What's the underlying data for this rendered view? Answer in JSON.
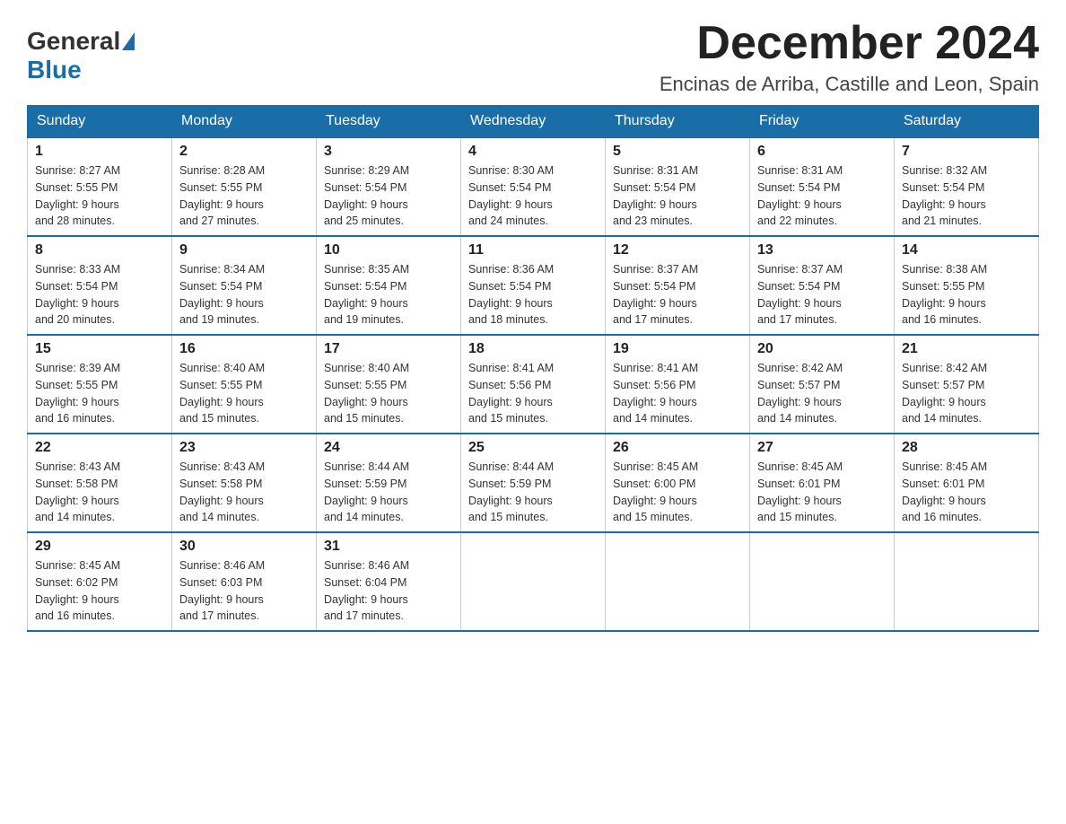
{
  "header": {
    "logo_general": "General",
    "logo_blue": "Blue",
    "month_title": "December 2024",
    "location": "Encinas de Arriba, Castille and Leon, Spain"
  },
  "weekdays": [
    "Sunday",
    "Monday",
    "Tuesday",
    "Wednesday",
    "Thursday",
    "Friday",
    "Saturday"
  ],
  "weeks": [
    [
      {
        "day": "1",
        "sunrise": "8:27 AM",
        "sunset": "5:55 PM",
        "daylight": "9 hours and 28 minutes."
      },
      {
        "day": "2",
        "sunrise": "8:28 AM",
        "sunset": "5:55 PM",
        "daylight": "9 hours and 27 minutes."
      },
      {
        "day": "3",
        "sunrise": "8:29 AM",
        "sunset": "5:54 PM",
        "daylight": "9 hours and 25 minutes."
      },
      {
        "day": "4",
        "sunrise": "8:30 AM",
        "sunset": "5:54 PM",
        "daylight": "9 hours and 24 minutes."
      },
      {
        "day": "5",
        "sunrise": "8:31 AM",
        "sunset": "5:54 PM",
        "daylight": "9 hours and 23 minutes."
      },
      {
        "day": "6",
        "sunrise": "8:31 AM",
        "sunset": "5:54 PM",
        "daylight": "9 hours and 22 minutes."
      },
      {
        "day": "7",
        "sunrise": "8:32 AM",
        "sunset": "5:54 PM",
        "daylight": "9 hours and 21 minutes."
      }
    ],
    [
      {
        "day": "8",
        "sunrise": "8:33 AM",
        "sunset": "5:54 PM",
        "daylight": "9 hours and 20 minutes."
      },
      {
        "day": "9",
        "sunrise": "8:34 AM",
        "sunset": "5:54 PM",
        "daylight": "9 hours and 19 minutes."
      },
      {
        "day": "10",
        "sunrise": "8:35 AM",
        "sunset": "5:54 PM",
        "daylight": "9 hours and 19 minutes."
      },
      {
        "day": "11",
        "sunrise": "8:36 AM",
        "sunset": "5:54 PM",
        "daylight": "9 hours and 18 minutes."
      },
      {
        "day": "12",
        "sunrise": "8:37 AM",
        "sunset": "5:54 PM",
        "daylight": "9 hours and 17 minutes."
      },
      {
        "day": "13",
        "sunrise": "8:37 AM",
        "sunset": "5:54 PM",
        "daylight": "9 hours and 17 minutes."
      },
      {
        "day": "14",
        "sunrise": "8:38 AM",
        "sunset": "5:55 PM",
        "daylight": "9 hours and 16 minutes."
      }
    ],
    [
      {
        "day": "15",
        "sunrise": "8:39 AM",
        "sunset": "5:55 PM",
        "daylight": "9 hours and 16 minutes."
      },
      {
        "day": "16",
        "sunrise": "8:40 AM",
        "sunset": "5:55 PM",
        "daylight": "9 hours and 15 minutes."
      },
      {
        "day": "17",
        "sunrise": "8:40 AM",
        "sunset": "5:55 PM",
        "daylight": "9 hours and 15 minutes."
      },
      {
        "day": "18",
        "sunrise": "8:41 AM",
        "sunset": "5:56 PM",
        "daylight": "9 hours and 15 minutes."
      },
      {
        "day": "19",
        "sunrise": "8:41 AM",
        "sunset": "5:56 PM",
        "daylight": "9 hours and 14 minutes."
      },
      {
        "day": "20",
        "sunrise": "8:42 AM",
        "sunset": "5:57 PM",
        "daylight": "9 hours and 14 minutes."
      },
      {
        "day": "21",
        "sunrise": "8:42 AM",
        "sunset": "5:57 PM",
        "daylight": "9 hours and 14 minutes."
      }
    ],
    [
      {
        "day": "22",
        "sunrise": "8:43 AM",
        "sunset": "5:58 PM",
        "daylight": "9 hours and 14 minutes."
      },
      {
        "day": "23",
        "sunrise": "8:43 AM",
        "sunset": "5:58 PM",
        "daylight": "9 hours and 14 minutes."
      },
      {
        "day": "24",
        "sunrise": "8:44 AM",
        "sunset": "5:59 PM",
        "daylight": "9 hours and 14 minutes."
      },
      {
        "day": "25",
        "sunrise": "8:44 AM",
        "sunset": "5:59 PM",
        "daylight": "9 hours and 15 minutes."
      },
      {
        "day": "26",
        "sunrise": "8:45 AM",
        "sunset": "6:00 PM",
        "daylight": "9 hours and 15 minutes."
      },
      {
        "day": "27",
        "sunrise": "8:45 AM",
        "sunset": "6:01 PM",
        "daylight": "9 hours and 15 minutes."
      },
      {
        "day": "28",
        "sunrise": "8:45 AM",
        "sunset": "6:01 PM",
        "daylight": "9 hours and 16 minutes."
      }
    ],
    [
      {
        "day": "29",
        "sunrise": "8:45 AM",
        "sunset": "6:02 PM",
        "daylight": "9 hours and 16 minutes."
      },
      {
        "day": "30",
        "sunrise": "8:46 AM",
        "sunset": "6:03 PM",
        "daylight": "9 hours and 17 minutes."
      },
      {
        "day": "31",
        "sunrise": "8:46 AM",
        "sunset": "6:04 PM",
        "daylight": "9 hours and 17 minutes."
      },
      null,
      null,
      null,
      null
    ]
  ],
  "labels": {
    "sunrise": "Sunrise:",
    "sunset": "Sunset:",
    "daylight": "Daylight:"
  }
}
